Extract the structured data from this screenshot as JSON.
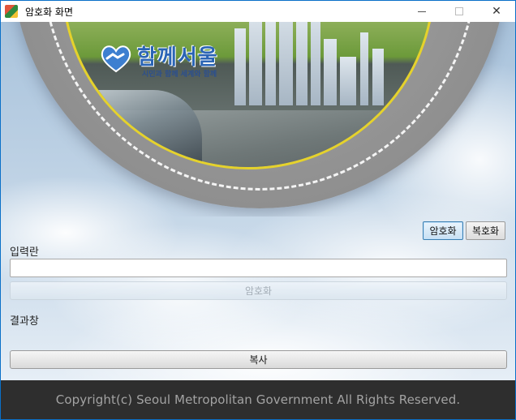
{
  "window": {
    "title": "암호화 화면",
    "app_icon": "seoul-app-icon",
    "controls": {
      "minimize_icon": "minimize-icon",
      "maximize_icon": "maximize-icon",
      "close_icon": "close-icon",
      "close_glyph": "✕"
    }
  },
  "banner": {
    "logo_title": "함께서울",
    "logo_subtitle": "시민과 함께 세계와 함께",
    "logo_icon": "heart-handshake-icon",
    "colors": {
      "logo_blue": "#2b65b5",
      "ring_yellow": "#e5d22c"
    }
  },
  "mode_buttons": {
    "encrypt_label": "암호화",
    "decrypt_label": "복호화",
    "selected": "암호화"
  },
  "input": {
    "label": "입력란",
    "value": "",
    "placeholder": ""
  },
  "actions": {
    "encrypt_label": "암호화",
    "copy_label": "복사"
  },
  "result": {
    "label": "결과창",
    "value": ""
  },
  "footer": {
    "text": "Copyright(c) Seoul Metropolitan Government All Rights Reserved."
  }
}
